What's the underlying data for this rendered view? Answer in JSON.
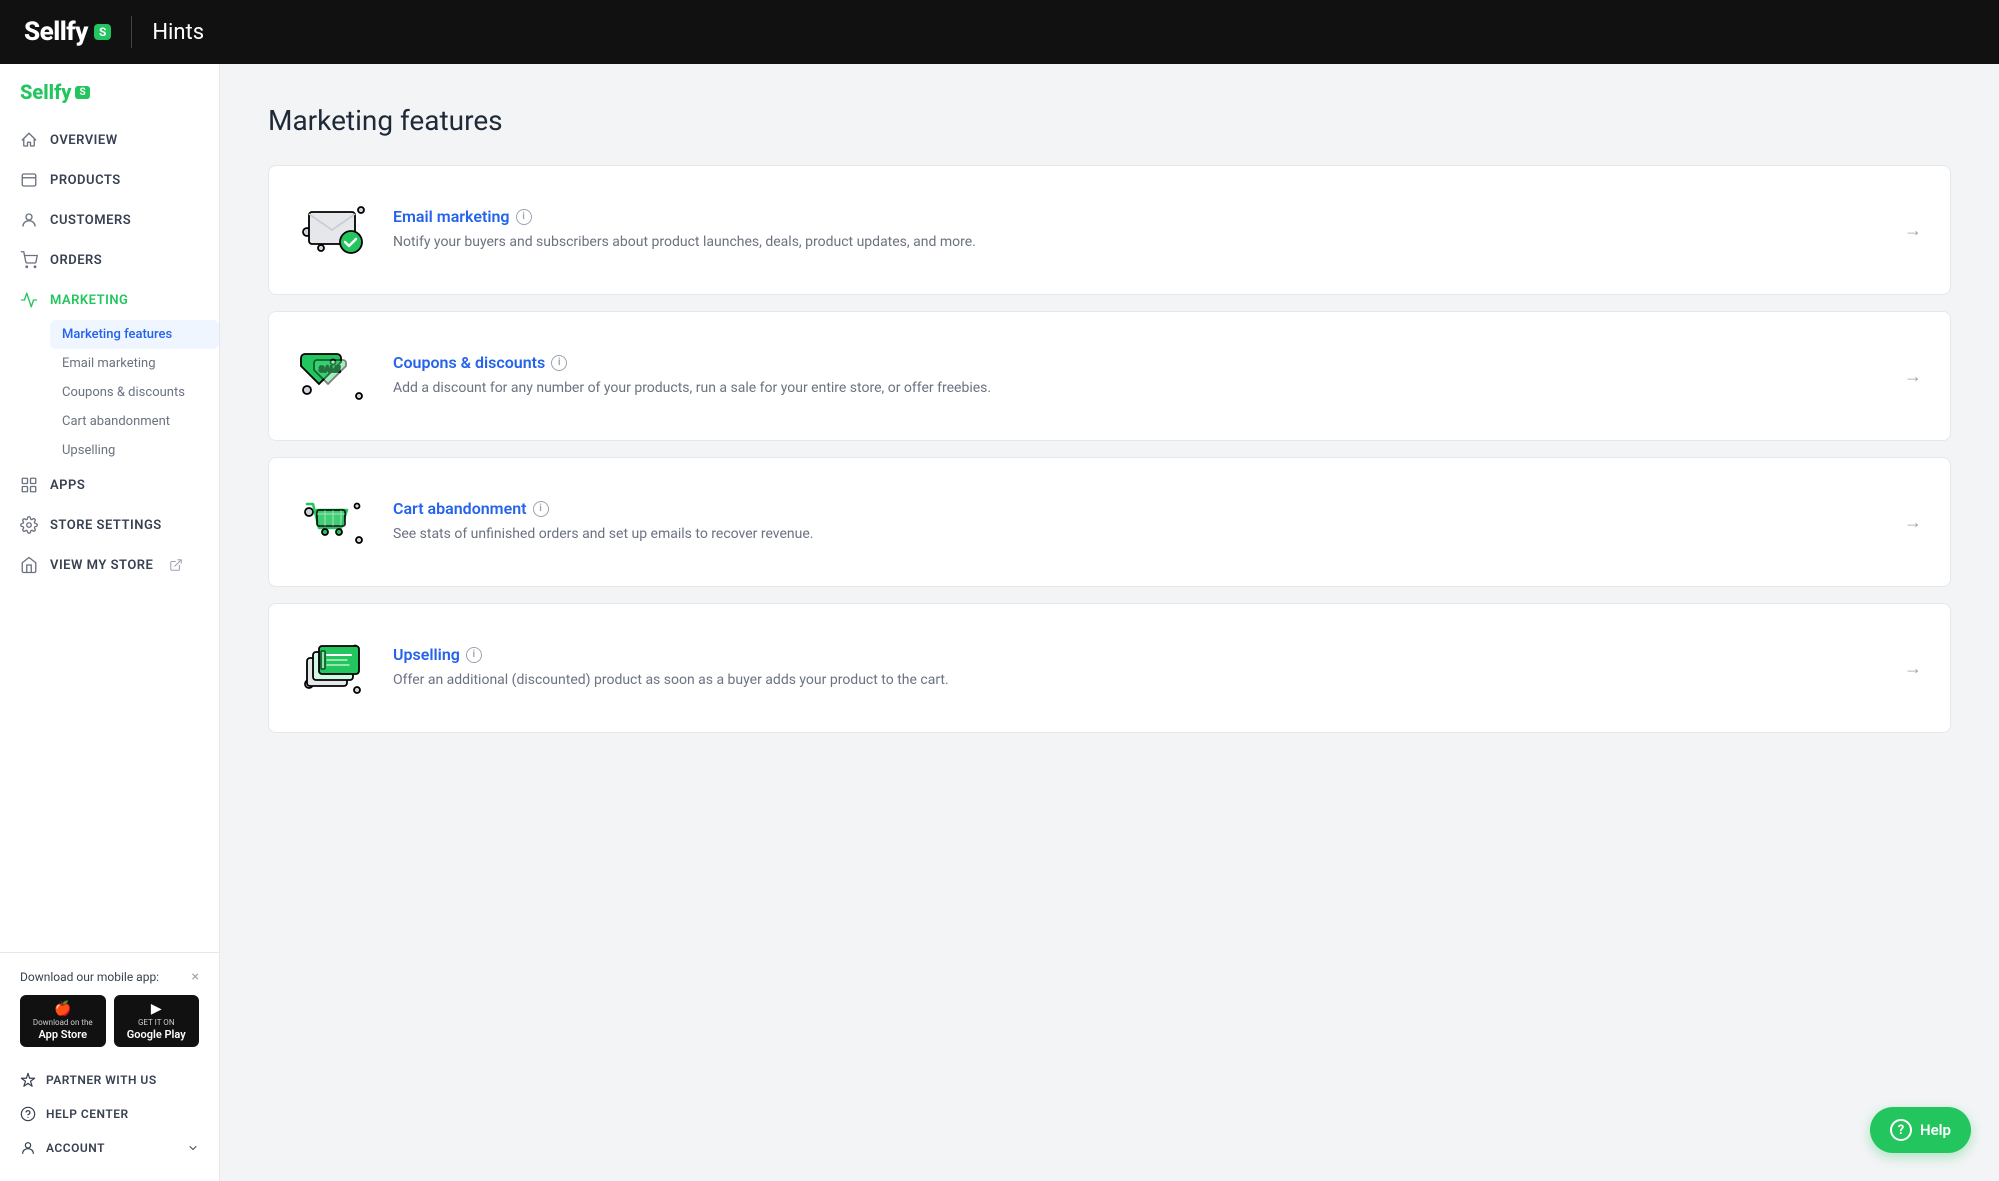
{
  "header": {
    "logo": "Sellfy",
    "logo_badge": "S",
    "divider": true,
    "title": "Hints"
  },
  "sidebar": {
    "logo": "Sellfy",
    "logo_badge": "S",
    "nav_items": [
      {
        "id": "overview",
        "label": "Overview",
        "icon": "home-icon"
      },
      {
        "id": "products",
        "label": "Products",
        "icon": "products-icon"
      },
      {
        "id": "customers",
        "label": "Customers",
        "icon": "customers-icon"
      },
      {
        "id": "orders",
        "label": "Orders",
        "icon": "orders-icon"
      },
      {
        "id": "marketing",
        "label": "Marketing",
        "icon": "marketing-icon",
        "active": true
      }
    ],
    "sub_nav": {
      "parent": "marketing",
      "items": [
        {
          "id": "marketing-features",
          "label": "Marketing features",
          "active": true
        },
        {
          "id": "email-marketing",
          "label": "Email marketing"
        },
        {
          "id": "coupons-discounts",
          "label": "Coupons & discounts"
        },
        {
          "id": "cart-abandonment",
          "label": "Cart abandonment"
        },
        {
          "id": "upselling",
          "label": "Upselling"
        }
      ]
    },
    "nav_items_bottom": [
      {
        "id": "apps",
        "label": "Apps",
        "icon": "apps-icon"
      },
      {
        "id": "store-settings",
        "label": "Store settings",
        "icon": "settings-icon"
      },
      {
        "id": "view-my-store",
        "label": "View my store",
        "icon": "store-icon",
        "external": true
      }
    ],
    "mobile_app": {
      "title": "Download our mobile app:",
      "close_label": "×",
      "app_store": {
        "label": "Download on the",
        "name": "App Store"
      },
      "google_play": {
        "label": "GET IT ON",
        "name": "Google Play"
      }
    },
    "footer_items": [
      {
        "id": "partner-with-us",
        "label": "Partner with us",
        "icon": "partner-icon"
      },
      {
        "id": "help-center",
        "label": "Help Center",
        "icon": "help-center-icon"
      },
      {
        "id": "account",
        "label": "Account",
        "icon": "account-icon"
      }
    ]
  },
  "content": {
    "page_title": "Marketing features",
    "features": [
      {
        "id": "email-marketing",
        "title": "Email marketing",
        "description": "Notify your buyers and subscribers about product launches, deals, product updates, and more.",
        "icon_type": "email"
      },
      {
        "id": "coupons-discounts",
        "title": "Coupons & discounts",
        "description": "Add a discount for any number of your products, run a sale for your entire store, or offer freebies.",
        "icon_type": "coupon"
      },
      {
        "id": "cart-abandonment",
        "title": "Cart abandonment",
        "description": "See stats of unfinished orders and set up emails to recover revenue.",
        "icon_type": "cart"
      },
      {
        "id": "upselling",
        "title": "Upselling",
        "description": "Offer an additional (discounted) product as soon as a buyer adds your product to the cart.",
        "icon_type": "upsell"
      }
    ]
  },
  "help_button": {
    "label": "Help"
  }
}
